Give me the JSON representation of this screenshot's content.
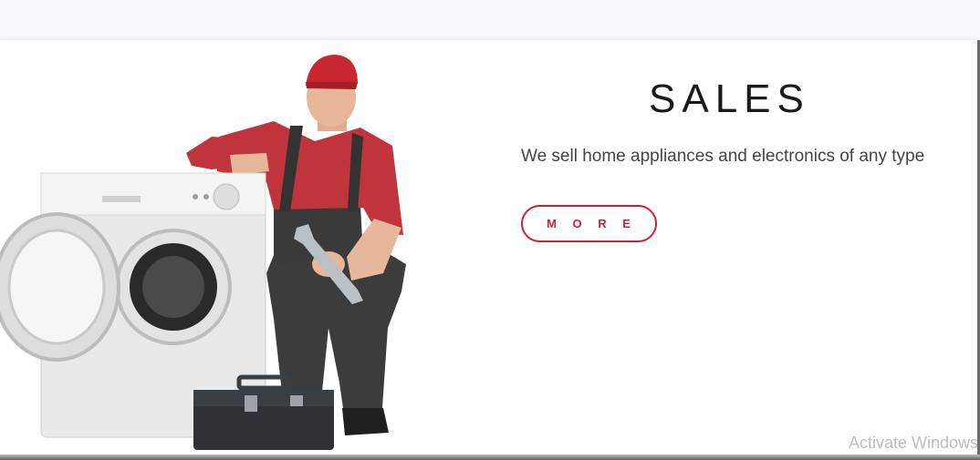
{
  "hero": {
    "title": "SALES",
    "description": "We sell home appliances and electronics of any type",
    "more_label": "M O R E"
  },
  "image": {
    "subject": "technician-with-washing-machine-and-toolbox"
  },
  "watermark": {
    "text": "Activate Windows"
  },
  "colors": {
    "accent": "#d0202f",
    "title": "#1a1a1a",
    "text": "#444444",
    "background": "#ffffff"
  }
}
